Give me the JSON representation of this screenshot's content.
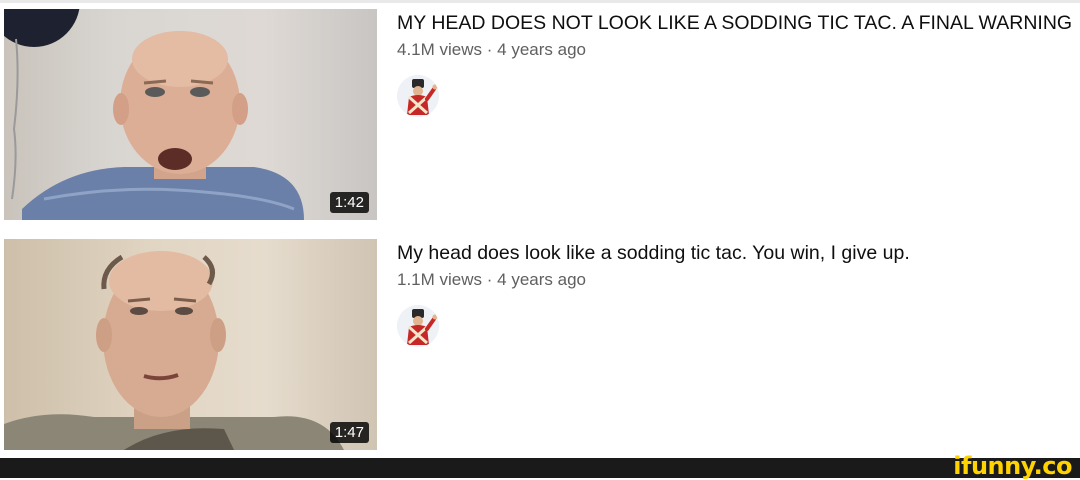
{
  "videos": [
    {
      "title": "MY HEAD DOES NOT LOOK LIKE A SODDING TIC TAC. A FINAL WARNING",
      "views": "4.1M views",
      "separator": "·",
      "age": "4 years ago",
      "duration": "1:42",
      "channel_avatar_icon": "soldier-avatar-icon"
    },
    {
      "title": "My head does look like a sodding tic tac. You win, I give up.",
      "views": "1.1M views",
      "separator": "·",
      "age": "4 years ago",
      "duration": "1:47",
      "channel_avatar_icon": "soldier-avatar-icon"
    }
  ],
  "watermark": {
    "text": "ifunny.co",
    "color": "#ffd200"
  }
}
